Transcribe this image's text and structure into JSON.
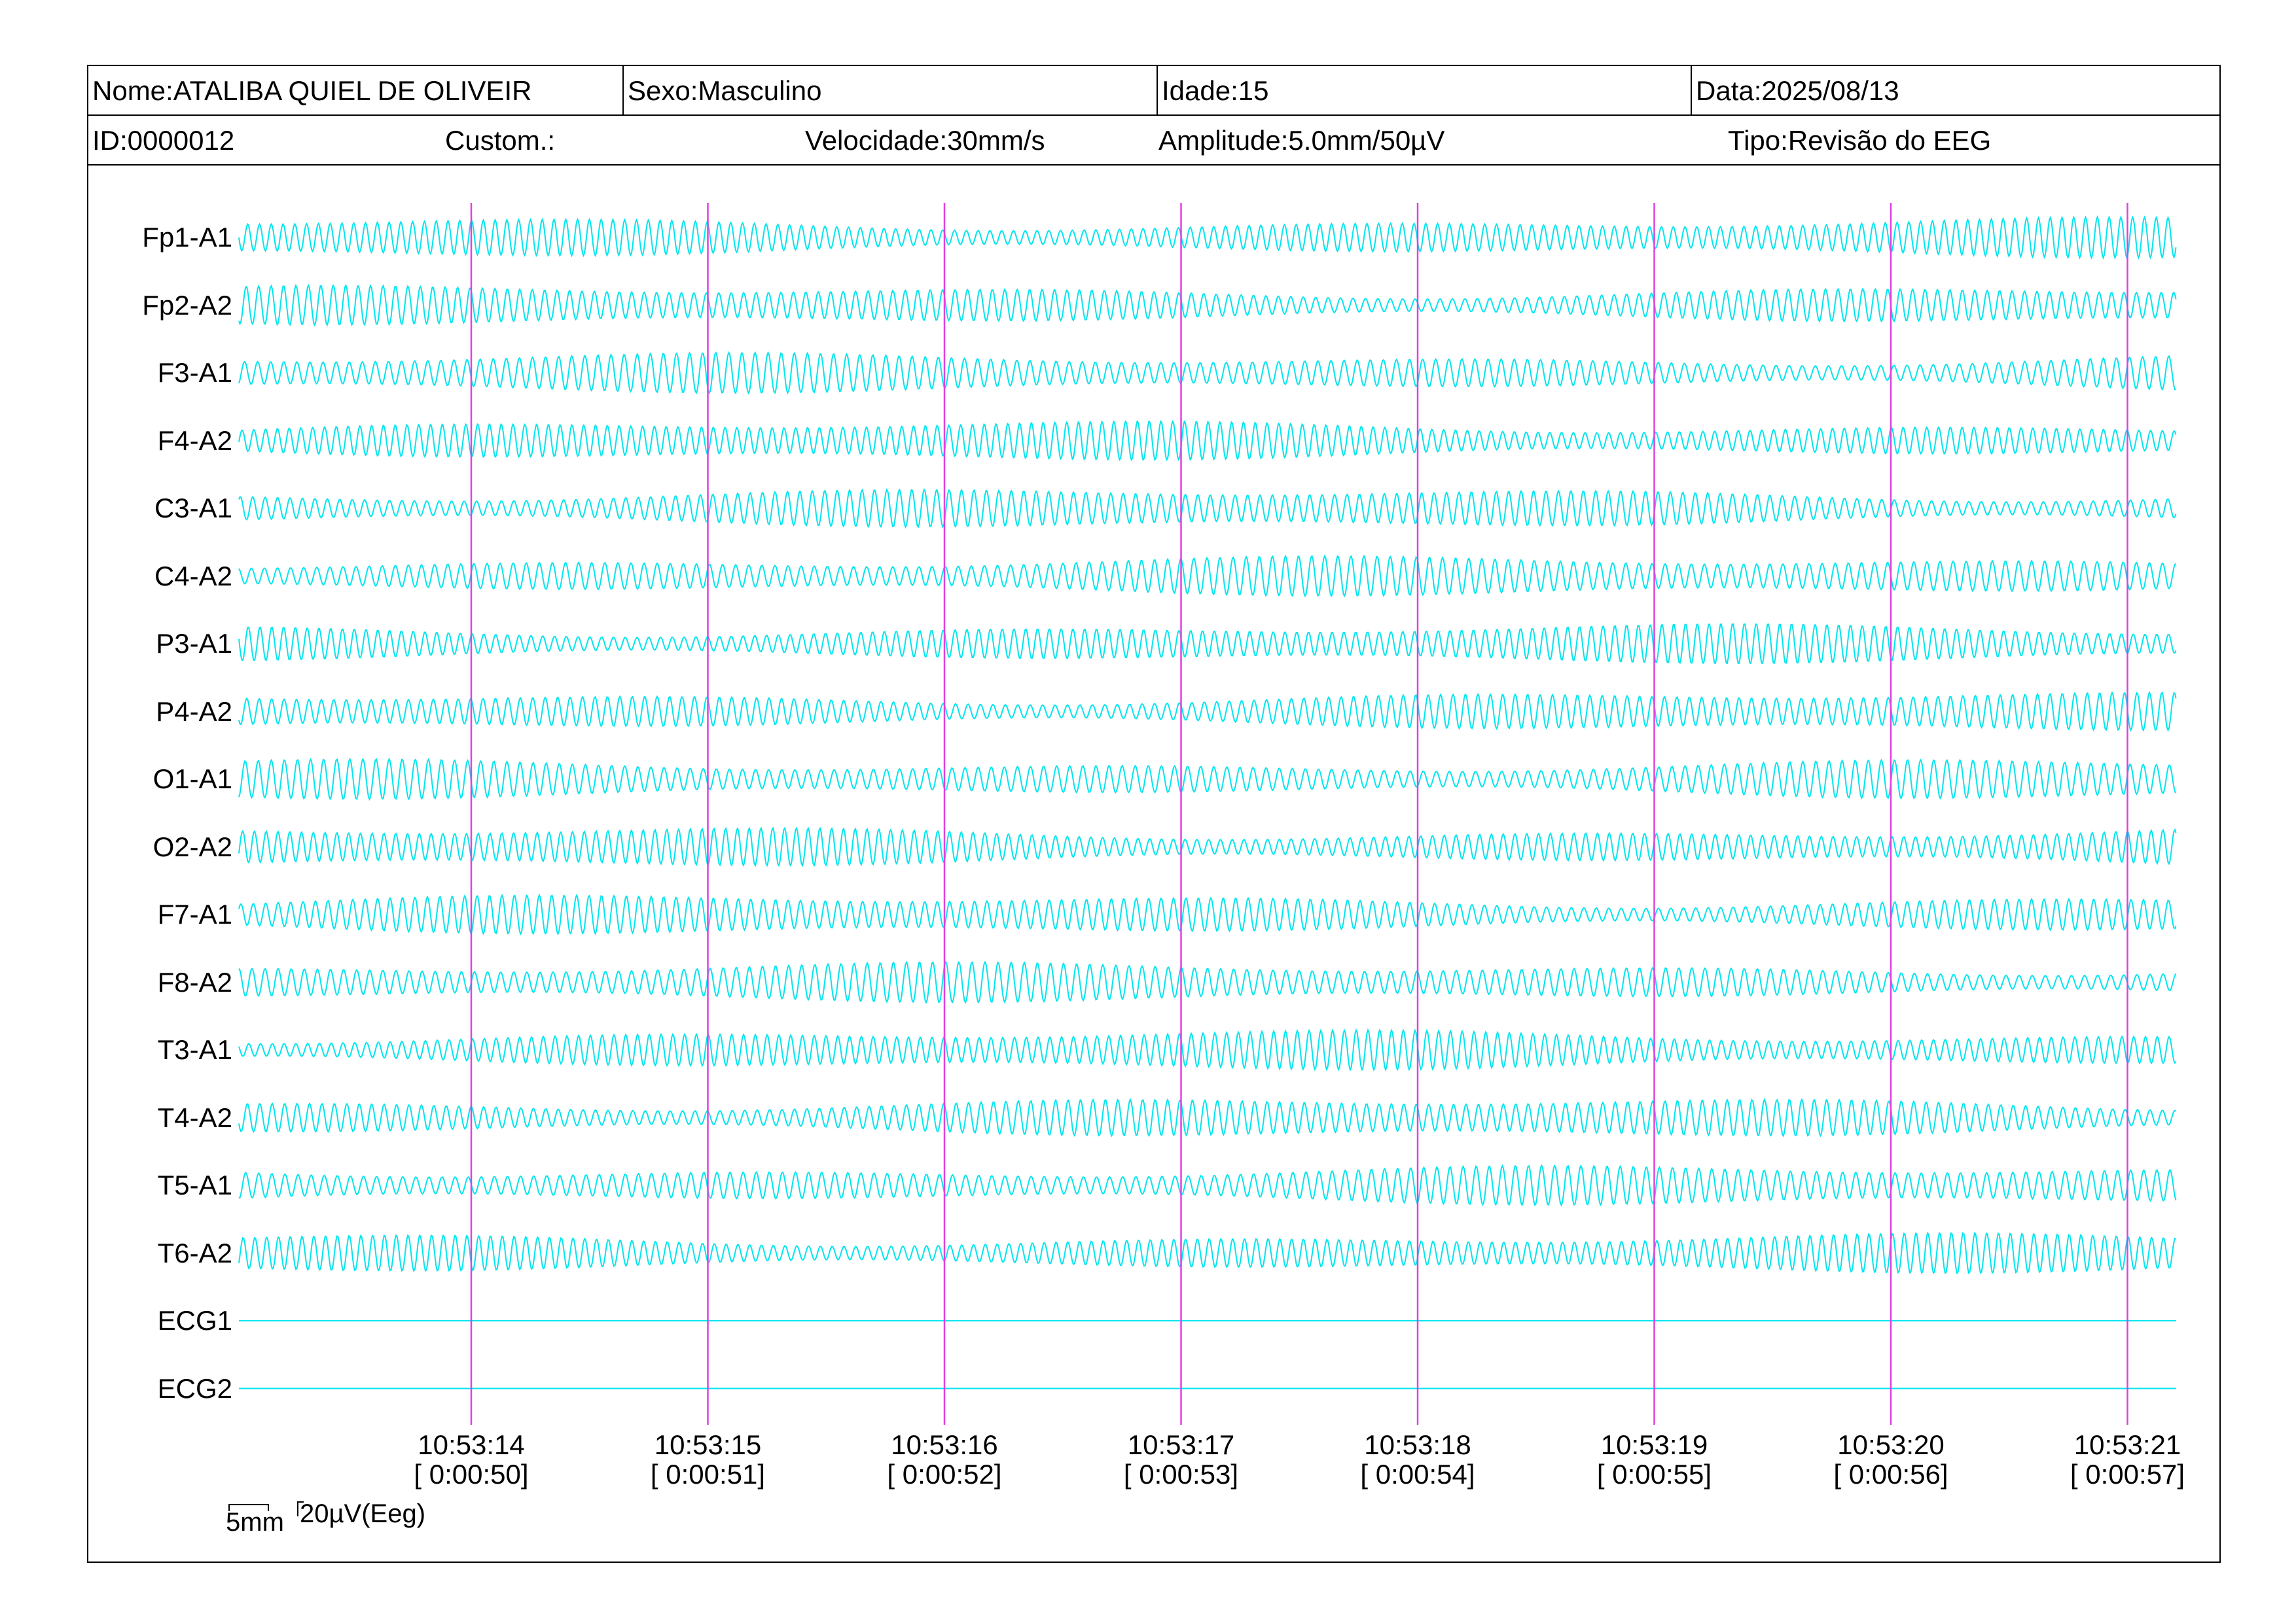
{
  "header": {
    "name": "Nome:ATALIBA QUIEL DE OLIVEIR",
    "sex": "Sexo:Masculino",
    "age": "Idade:15",
    "date": "Data:2025/08/13",
    "id": "ID:0000012",
    "custom": "Custom.:",
    "speed": "Velocidade:30mm/s",
    "amplitude": "Amplitude:5.0mm/50µV",
    "type": "Tipo:Revisão do EEG"
  },
  "channels": [
    "Fp1-A1",
    "Fp2-A2",
    "F3-A1",
    "F4-A2",
    "C3-A1",
    "C4-A2",
    "P3-A1",
    "P4-A2",
    "O1-A1",
    "O2-A2",
    "F7-A1",
    "F8-A2",
    "T3-A1",
    "T4-A2",
    "T5-A1",
    "T6-A2",
    "ECG1",
    "ECG2"
  ],
  "markers": [
    {
      "time": "10:53:14",
      "elapsed": "[ 0:00:50]"
    },
    {
      "time": "10:53:15",
      "elapsed": "[ 0:00:51]"
    },
    {
      "time": "10:53:16",
      "elapsed": "[ 0:00:52]"
    },
    {
      "time": "10:53:17",
      "elapsed": "[ 0:00:53]"
    },
    {
      "time": "10:53:18",
      "elapsed": "[ 0:00:54]"
    },
    {
      "time": "10:53:19",
      "elapsed": "[ 0:00:55]"
    },
    {
      "time": "10:53:20",
      "elapsed": "[ 0:00:56]"
    },
    {
      "time": "10:53:21",
      "elapsed": "[ 0:00:57]"
    }
  ],
  "scale": {
    "time_bar": "5mm",
    "amp_bar": "20µV(Eeg)"
  },
  "colors": {
    "trace": "#00e5ee",
    "marker": "#e040e0"
  }
}
